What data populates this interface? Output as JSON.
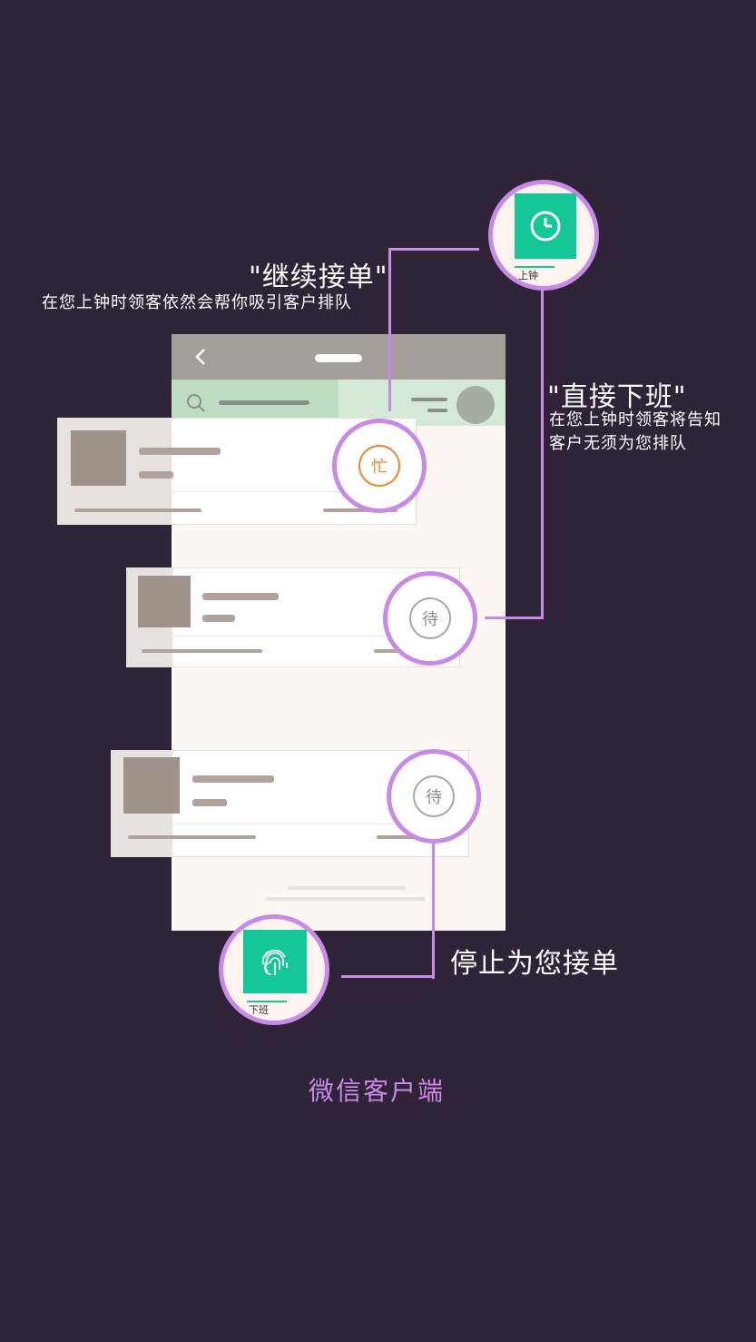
{
  "callouts": {
    "continue": {
      "title": "\"继续接单\"",
      "subtitle": "在您上钟时领客依然会帮你吸引客户排队"
    },
    "off_duty": {
      "title": "\"直接下班\"",
      "subtitle_line1": "在您上钟时领客将告知",
      "subtitle_line2": "客户无须为您排队"
    },
    "stop": {
      "title": "停止为您接单"
    }
  },
  "apps": {
    "on_duty": {
      "label": "上钟",
      "icon": "clock-icon",
      "color": "#13c796"
    },
    "off_duty": {
      "label": "下班",
      "icon": "fingerprint-icon",
      "color": "#13c796"
    }
  },
  "list": {
    "items": [
      {
        "status": "忙",
        "status_color": "#e9862e"
      },
      {
        "status": "待",
        "status_color": "#8c8c8c"
      },
      {
        "status": "待",
        "status_color": "#8c8c8c"
      }
    ]
  },
  "footer": {
    "caption": "微信客户端"
  },
  "colors": {
    "background": "#2f2437",
    "accent": "#c88ae6",
    "brand": "#13c796"
  }
}
